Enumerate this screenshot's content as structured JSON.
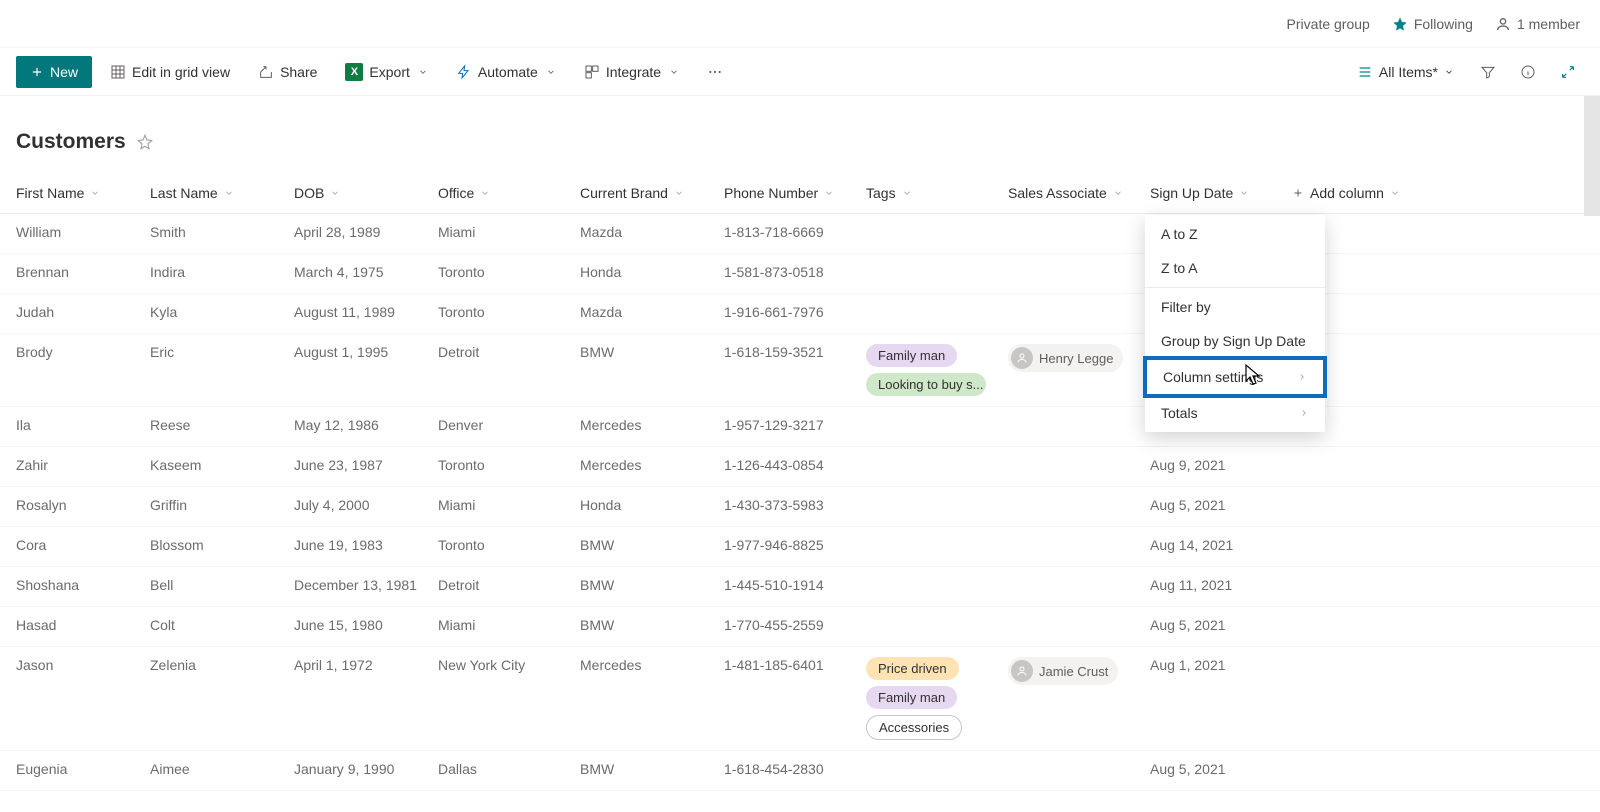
{
  "topbar": {
    "group_type": "Private group",
    "following": "Following",
    "members": "1 member"
  },
  "toolbar": {
    "new_label": "New",
    "edit_grid": "Edit in grid view",
    "share": "Share",
    "export": "Export",
    "automate": "Automate",
    "integrate": "Integrate",
    "view_name": "All Items*"
  },
  "list": {
    "title": "Customers"
  },
  "columns": {
    "first": "First Name",
    "last": "Last Name",
    "dob": "DOB",
    "office": "Office",
    "brand": "Current Brand",
    "phone": "Phone Number",
    "tags": "Tags",
    "assoc": "Sales Associate",
    "signup": "Sign Up Date",
    "add": "Add column"
  },
  "rows": [
    {
      "first": "William",
      "last": "Smith",
      "dob": "April 28, 1989",
      "office": "Miami",
      "brand": "Mazda",
      "phone": "1-813-718-6669",
      "tags": [],
      "assoc": "",
      "signup": ""
    },
    {
      "first": "Brennan",
      "last": "Indira",
      "dob": "March 4, 1975",
      "office": "Toronto",
      "brand": "Honda",
      "phone": "1-581-873-0518",
      "tags": [],
      "assoc": "",
      "signup": ""
    },
    {
      "first": "Judah",
      "last": "Kyla",
      "dob": "August 11, 1989",
      "office": "Toronto",
      "brand": "Mazda",
      "phone": "1-916-661-7976",
      "tags": [],
      "assoc": "",
      "signup": ""
    },
    {
      "first": "Brody",
      "last": "Eric",
      "dob": "August 1, 1995",
      "office": "Detroit",
      "brand": "BMW",
      "phone": "1-618-159-3521",
      "tags": [
        {
          "t": "Family man",
          "c": "purple"
        },
        {
          "t": "Looking to buy s...",
          "c": "green"
        }
      ],
      "assoc": "Henry Legge",
      "signup": ""
    },
    {
      "first": "Ila",
      "last": "Reese",
      "dob": "May 12, 1986",
      "office": "Denver",
      "brand": "Mercedes",
      "phone": "1-957-129-3217",
      "tags": [],
      "assoc": "",
      "signup": ""
    },
    {
      "first": "Zahir",
      "last": "Kaseem",
      "dob": "June 23, 1987",
      "office": "Toronto",
      "brand": "Mercedes",
      "phone": "1-126-443-0854",
      "tags": [],
      "assoc": "",
      "signup": "Aug 9, 2021"
    },
    {
      "first": "Rosalyn",
      "last": "Griffin",
      "dob": "July 4, 2000",
      "office": "Miami",
      "brand": "Honda",
      "phone": "1-430-373-5983",
      "tags": [],
      "assoc": "",
      "signup": "Aug 5, 2021"
    },
    {
      "first": "Cora",
      "last": "Blossom",
      "dob": "June 19, 1983",
      "office": "Toronto",
      "brand": "BMW",
      "phone": "1-977-946-8825",
      "tags": [],
      "assoc": "",
      "signup": "Aug 14, 2021"
    },
    {
      "first": "Shoshana",
      "last": "Bell",
      "dob": "December 13, 1981",
      "office": "Detroit",
      "brand": "BMW",
      "phone": "1-445-510-1914",
      "tags": [],
      "assoc": "",
      "signup": "Aug 11, 2021"
    },
    {
      "first": "Hasad",
      "last": "Colt",
      "dob": "June 15, 1980",
      "office": "Miami",
      "brand": "BMW",
      "phone": "1-770-455-2559",
      "tags": [],
      "assoc": "",
      "signup": "Aug 5, 2021"
    },
    {
      "first": "Jason",
      "last": "Zelenia",
      "dob": "April 1, 1972",
      "office": "New York City",
      "brand": "Mercedes",
      "phone": "1-481-185-6401",
      "tags": [
        {
          "t": "Price driven",
          "c": "yellow"
        },
        {
          "t": "Family man",
          "c": "purple"
        },
        {
          "t": "Accessories",
          "c": "outline"
        }
      ],
      "assoc": "Jamie Crust",
      "signup": "Aug 1, 2021"
    },
    {
      "first": "Eugenia",
      "last": "Aimee",
      "dob": "January 9, 1990",
      "office": "Dallas",
      "brand": "BMW",
      "phone": "1-618-454-2830",
      "tags": [],
      "assoc": "",
      "signup": "Aug 5, 2021"
    }
  ],
  "dropdown": {
    "a_to_z": "A to Z",
    "z_to_a": "Z to A",
    "filter_by": "Filter by",
    "group_by": "Group by Sign Up Date",
    "column_settings": "Column settings",
    "totals": "Totals"
  }
}
